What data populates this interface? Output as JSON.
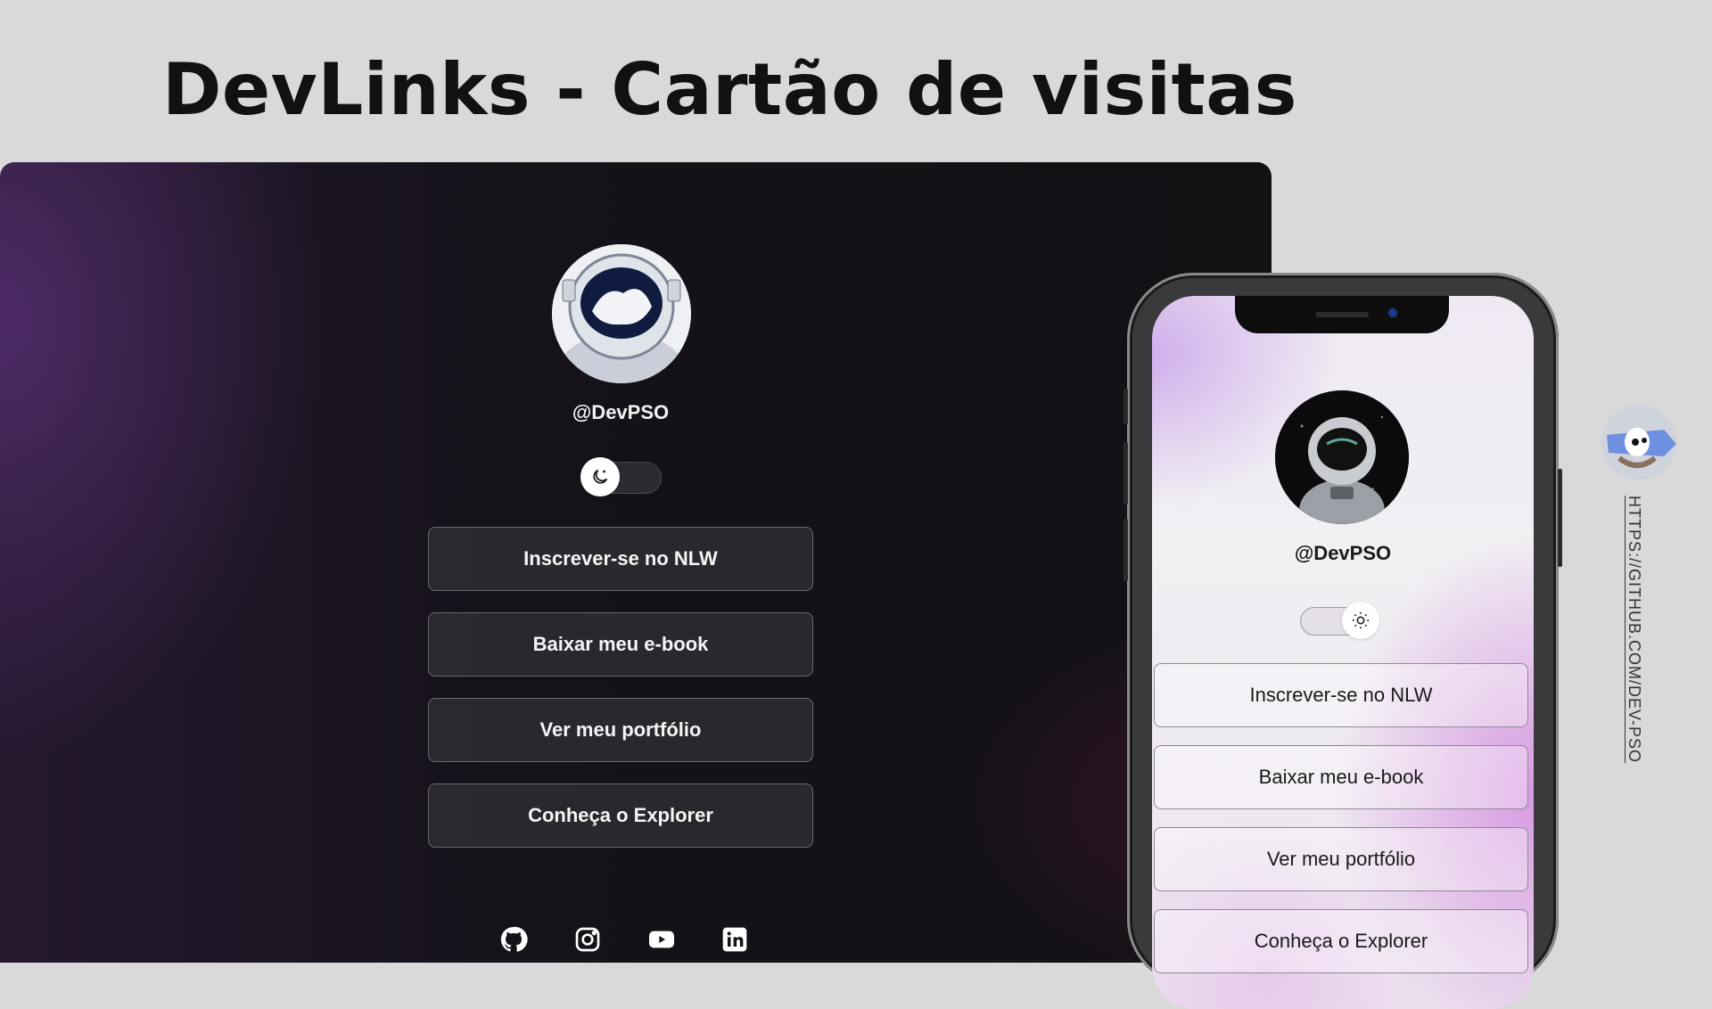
{
  "page": {
    "title": "DevLinks - Cartão de visitas",
    "github_url": "HTTPS://GITHUB.COM/DEV-PSO"
  },
  "desktop": {
    "handle": "@DevPSO",
    "theme": "dark",
    "toggle_icon": "moon-icon",
    "buttons": [
      {
        "label": "Inscrever-se no NLW"
      },
      {
        "label": "Baixar meu e-book"
      },
      {
        "label": "Ver meu portfólio"
      },
      {
        "label": "Conheça o Explorer"
      }
    ],
    "social": [
      "github-icon",
      "instagram-icon",
      "youtube-icon",
      "linkedin-icon"
    ]
  },
  "mobile": {
    "handle": "@DevPSO",
    "theme": "light",
    "toggle_icon": "sun-icon",
    "buttons": [
      {
        "label": "Inscrever-se no NLW"
      },
      {
        "label": "Baixar meu e-book"
      },
      {
        "label": "Ver meu portfólio"
      },
      {
        "label": "Conheça o Explorer"
      }
    ]
  },
  "colors": {
    "background": "#d9d9d9",
    "desktop_bg": "#151219",
    "desktop_accent": "#542e6e",
    "mobile_accent": "#d696e1"
  }
}
